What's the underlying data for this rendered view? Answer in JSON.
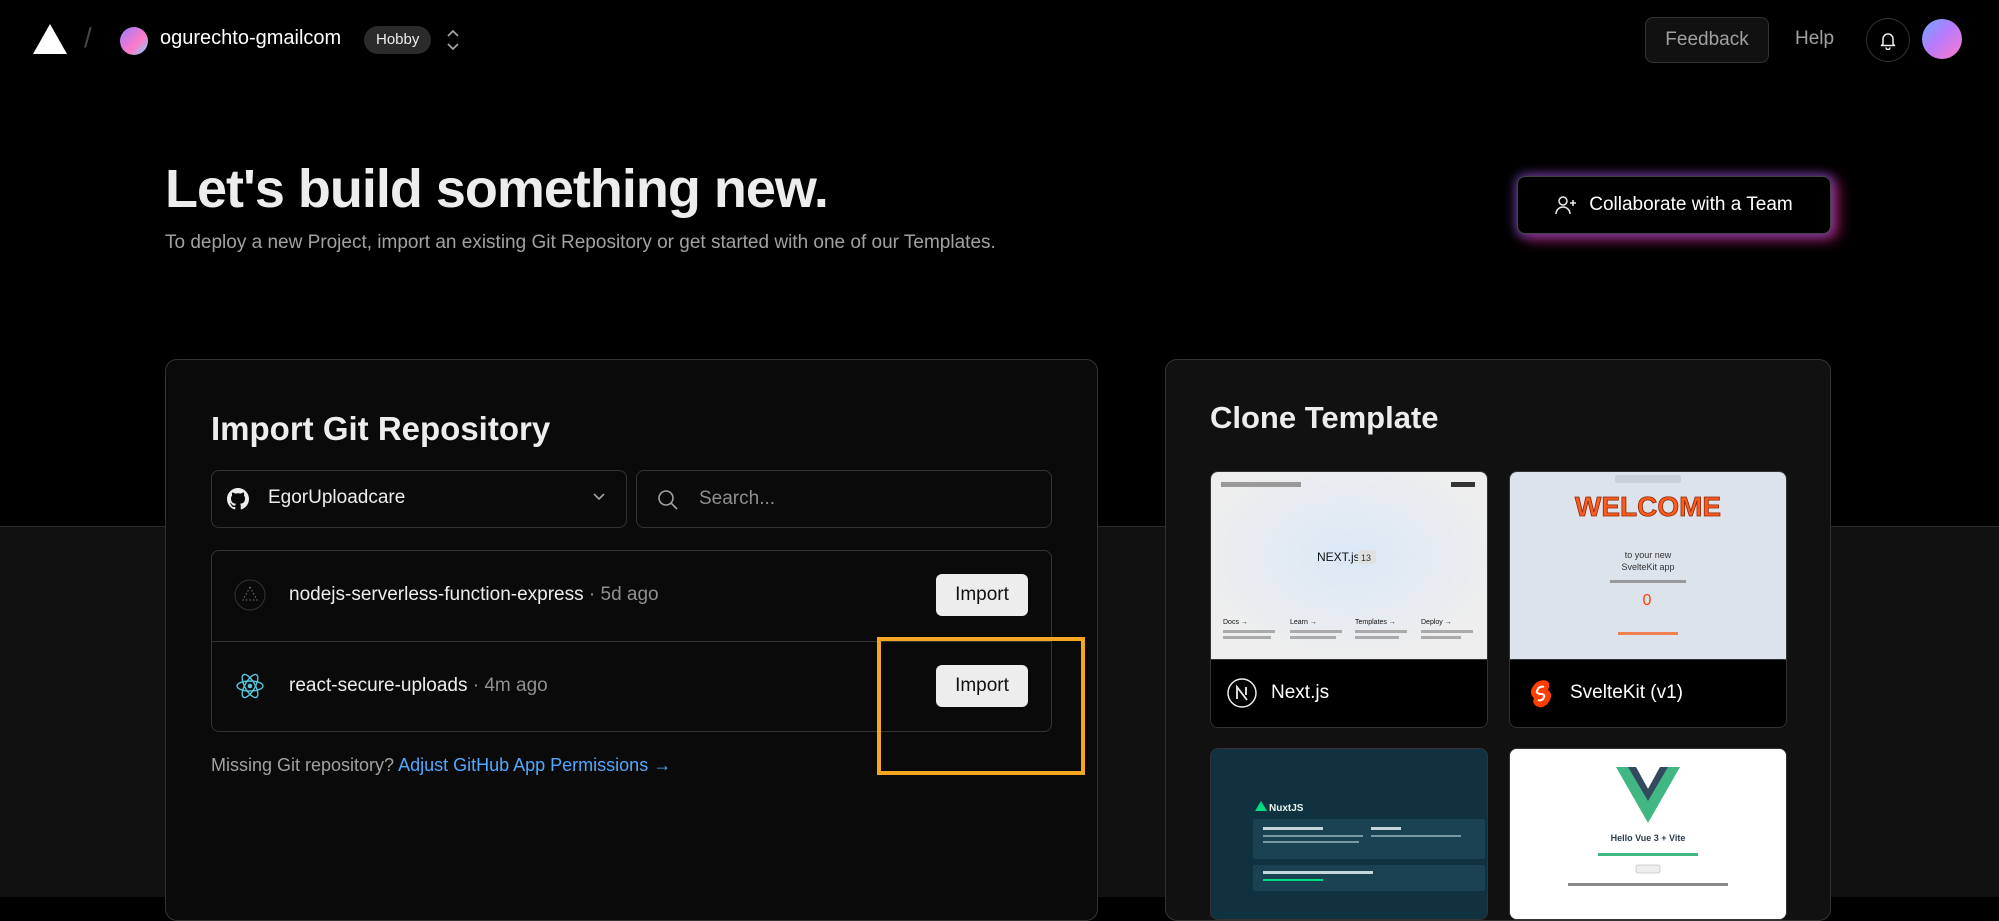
{
  "nav": {
    "team_name": "ogurechto-gmailcom",
    "plan": "Hobby",
    "feedback": "Feedback",
    "help": "Help"
  },
  "hero": {
    "title": "Let's build something new.",
    "subtitle": "To deploy a new Project, import an existing Git Repository or get started with one of our Templates.",
    "collaborate": "Collaborate with a Team"
  },
  "import": {
    "title": "Import Git Repository",
    "account": "EgorUploadcare",
    "search_placeholder": "Search...",
    "repos": [
      {
        "name": "nodejs-serverless-function-express",
        "meta": " · 5d ago",
        "action": "Import",
        "icon": "triangle-dots-icon"
      },
      {
        "name": "react-secure-uploads",
        "meta": " · 4m ago",
        "action": "Import",
        "icon": "react-icon"
      }
    ],
    "missing_text": "Missing Git repository? ",
    "missing_link": "Adjust GitHub App Permissions →"
  },
  "clone": {
    "title": "Clone Template",
    "templates": [
      {
        "name": "Next.js",
        "icon": "nextjs-icon"
      },
      {
        "name": "SvelteKit (v1)",
        "icon": "svelte-icon"
      }
    ],
    "thumbs": {
      "nextjs": {
        "logo": "NEXT.js",
        "version": "13",
        "links": [
          "Docs →",
          "Learn →",
          "Templates →",
          "Deploy →"
        ]
      },
      "svelte": {
        "welcome": "WELCOME",
        "line1": "to your new",
        "line2": "SvelteKit app",
        "counter": "0"
      },
      "nuxt": {
        "logo": "NuxtJS"
      },
      "vue": {
        "title": "Hello Vue 3 + Vite"
      }
    }
  },
  "colors": {
    "accent_link": "#52a8ff",
    "highlight": "#f5a623",
    "import_button": "#ededed"
  }
}
